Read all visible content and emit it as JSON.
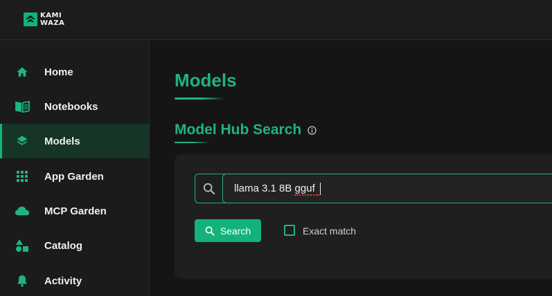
{
  "brand": {
    "line1": "KAMI",
    "line2": "WAZA"
  },
  "sidebar": {
    "items": [
      {
        "label": "Home",
        "icon": "home-icon",
        "active": false
      },
      {
        "label": "Notebooks",
        "icon": "book-icon",
        "active": false
      },
      {
        "label": "Models",
        "icon": "layers-icon",
        "active": true
      },
      {
        "label": "App Garden",
        "icon": "apps-grid-icon",
        "active": false
      },
      {
        "label": "MCP Garden",
        "icon": "cloud-icon",
        "active": false
      },
      {
        "label": "Catalog",
        "icon": "shapes-icon",
        "active": false
      },
      {
        "label": "Activity",
        "icon": "bell-icon",
        "active": false
      }
    ]
  },
  "main": {
    "title": "Models",
    "section_title": "Model Hub Search",
    "search": {
      "value": "llama 3.1 8B gguf",
      "button_label": "Search"
    },
    "exact_match": {
      "label": "Exact match",
      "checked": false
    }
  },
  "colors": {
    "accent": "#1fb47f",
    "active_bg": "#163527",
    "background": "#151515"
  }
}
